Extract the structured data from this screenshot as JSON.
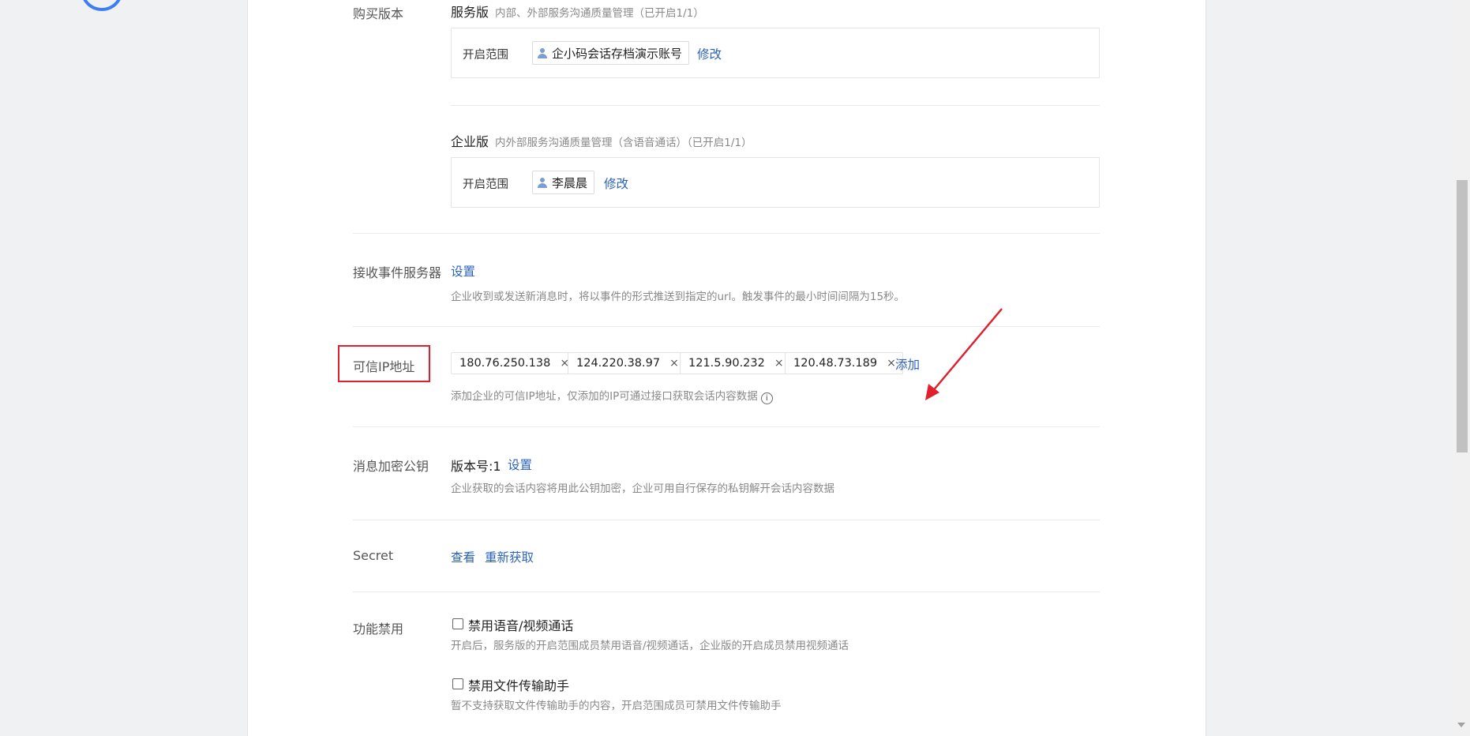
{
  "purchase": {
    "label": "购买版本",
    "service_edition": {
      "title": "服务版",
      "desc": "内部、外部服务沟通质量管理（已开启1/1）",
      "scope_label": "开启范围",
      "member": "企小码会话存档演示账号",
      "edit_label": "修改"
    },
    "enterprise_edition": {
      "title": "企业版",
      "desc": "内外部服务沟通质量管理（含语音通话）（已开启1/1）",
      "scope_label": "开启范围",
      "member": "李晨晨",
      "edit_label": "修改"
    }
  },
  "event_server": {
    "label": "接收事件服务器",
    "action": "设置",
    "help": "企业收到或发送新消息时，将以事件的形式推送到指定的url。触发事件的最小时间间隔为15秒。"
  },
  "trusted_ip": {
    "label": "可信IP地址",
    "ips": [
      "180.76.250.138",
      "124.220.38.97",
      "121.5.90.232",
      "120.48.73.189"
    ],
    "add_label": "添加",
    "help": "添加企业的可信IP地址，仅添加的IP可通过接口获取会话内容数据",
    "info_glyph": "i",
    "remove_glyph": "×"
  },
  "encryption_key": {
    "label": "消息加密公钥",
    "version": "版本号:1",
    "action": "设置",
    "help": "企业获取的会话内容将用此公钥加密，企业可用自行保存的私钥解开会话内容数据"
  },
  "secret": {
    "label": "Secret",
    "view_label": "查看",
    "refetch_label": "重新获取"
  },
  "disable_features": {
    "label": "功能禁用",
    "items": [
      {
        "title": "禁用语音/视频通话",
        "help": "开启后，服务版的开启范围成员禁用语音/视频通话，企业版的开启成员禁用视频通话",
        "checked": false
      },
      {
        "title": "禁用文件传输助手",
        "help": "暂不支持获取文件传输助手的内容，开启范围成员可禁用文件传输助手",
        "checked": false
      }
    ]
  },
  "colors": {
    "link": "#2c63b8",
    "highlight": "#e0202c",
    "annotation_arrow": "#e0202c"
  }
}
